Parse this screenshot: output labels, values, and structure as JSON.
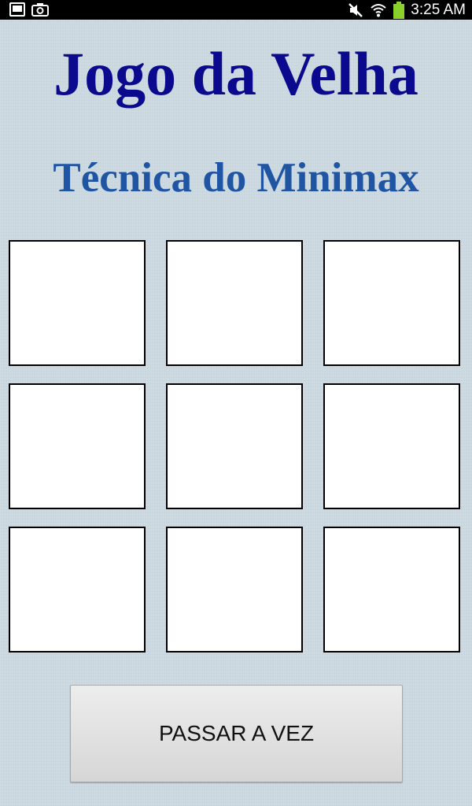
{
  "status_bar": {
    "time": "3:25 AM",
    "left_icons": [
      "gallery-icon",
      "camera-icon"
    ],
    "right_icons": [
      "mute-icon",
      "wifi-icon",
      "battery-icon"
    ],
    "battery_color": "#8ad12c"
  },
  "game": {
    "title": "Jogo da Velha",
    "subtitle": "Técnica do Minimax",
    "board": [
      [
        "",
        "",
        ""
      ],
      [
        "",
        "",
        ""
      ],
      [
        "",
        "",
        ""
      ]
    ],
    "pass_button_label": "PASSAR A VEZ"
  },
  "colors": {
    "title": "#0b0a8f",
    "subtitle": "#1f55a3",
    "background": "#cbd8e0"
  }
}
